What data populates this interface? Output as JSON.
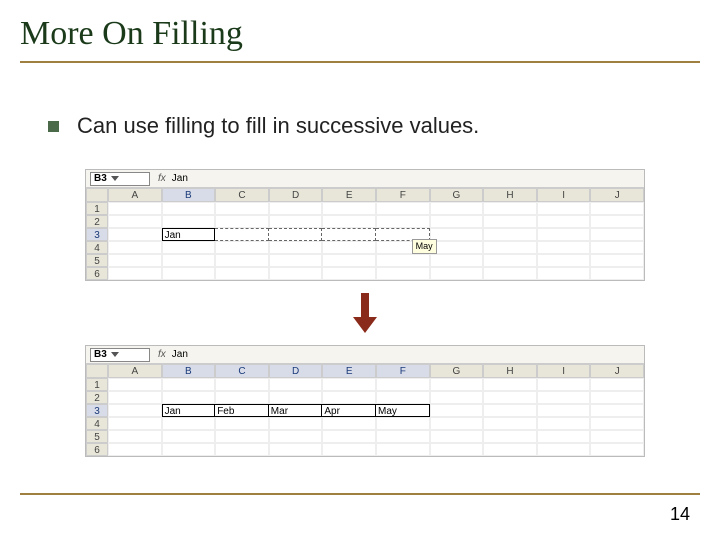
{
  "title": "More On Filling",
  "bullet_text": "Can use filling to fill in successive values.",
  "page_number": "14",
  "sheet1": {
    "namebox": "B3",
    "fx_label": "fx",
    "formula_value": "Jan",
    "columns": [
      "A",
      "B",
      "C",
      "D",
      "E",
      "F",
      "G",
      "H",
      "I",
      "J"
    ],
    "rows": [
      "1",
      "2",
      "3",
      "4",
      "5",
      "6"
    ],
    "b3": "Jan",
    "tooltip": "May"
  },
  "sheet2": {
    "namebox": "B3",
    "fx_label": "fx",
    "formula_value": "Jan",
    "columns": [
      "A",
      "B",
      "C",
      "D",
      "E",
      "F",
      "G",
      "H",
      "I",
      "J"
    ],
    "rows": [
      "1",
      "2",
      "3",
      "4",
      "5",
      "6"
    ],
    "b3": "Jan",
    "c3": "Feb",
    "d3": "Mar",
    "e3": "Apr",
    "f3": "May"
  }
}
